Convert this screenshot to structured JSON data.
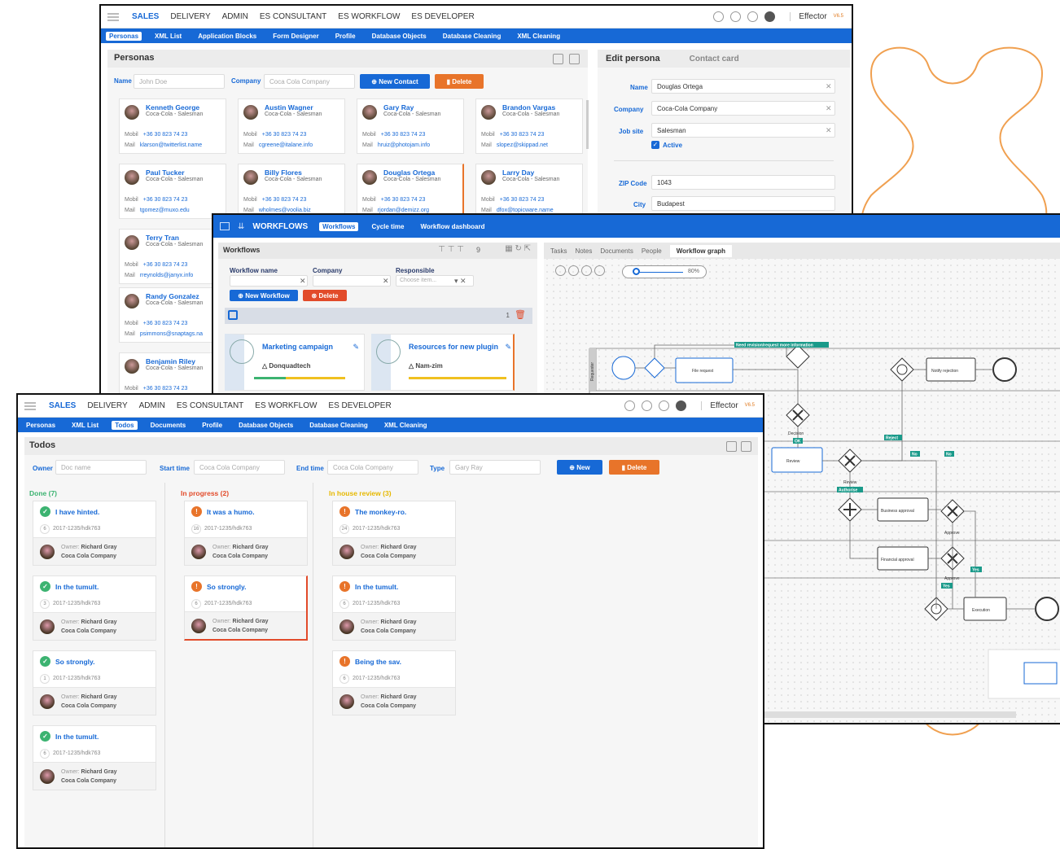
{
  "top_nav": {
    "items": [
      "SALES",
      "DELIVERY",
      "ADMIN",
      "ES CONSULTANT",
      "ES WORKFLOW",
      "ES DEVELOPER"
    ],
    "brand": "Effector",
    "version": "V6.5"
  },
  "personas_window": {
    "subnav": [
      "Personas",
      "XML List",
      "Application Blocks",
      "Form Designer",
      "Profile",
      "Database Objects",
      "Database Cleaning",
      "XML Cleaning"
    ],
    "title": "Personas",
    "filter": {
      "name_label": "Name",
      "name_placeholder": "John Doe",
      "company_label": "Company",
      "company_placeholder": "Coca Cola Company",
      "new_button": "New Contact",
      "delete_button": "Delete"
    },
    "mobil_label": "Mobil",
    "mail_label": "Mail",
    "contacts": [
      {
        "name": "Kenneth George",
        "role": "Coca-Cola - Salesman",
        "mobil": "+36 30 823 74 23",
        "mail": "klarson@twitterlist.name"
      },
      {
        "name": "Austin Wagner",
        "role": "Coca-Cola - Salesman",
        "mobil": "+36 30 823 74 23",
        "mail": "cgreene@italane.info"
      },
      {
        "name": "Gary Ray",
        "role": "Coca-Cola - Salesman",
        "mobil": "+36 30 823 74 23",
        "mail": "hruiz@photojam.info"
      },
      {
        "name": "Brandon Vargas",
        "role": "Coca-Cola - Salesman",
        "mobil": "+36 30 823 74 23",
        "mail": "slopez@skippad.net"
      },
      {
        "name": "Paul Tucker",
        "role": "Coca-Cola - Salesman",
        "mobil": "+36 30 823 74 23",
        "mail": "tgomez@muxo.edu"
      },
      {
        "name": "Billy Flores",
        "role": "Coca-Cola - Salesman",
        "mobil": "+36 30 823 74 23",
        "mail": "wholmes@voolia.biz"
      },
      {
        "name": "Douglas Ortega",
        "role": "Coca-Cola - Salesman",
        "mobil": "+36 30 823 74 23",
        "mail": "rjordan@demizz.org"
      },
      {
        "name": "Larry Day",
        "role": "Coca-Cola - Salesman",
        "mobil": "+36 30 823 74 23",
        "mail": "dfox@topicware.name"
      },
      {
        "name": "Terry Tran",
        "role": "Coca-Cola - Salesman",
        "mobil": "+36 30 823 74 23",
        "mail": "rreynolds@janyx.info"
      },
      {
        "name": "Randy Gonzalez",
        "role": "Coca-Cola - Salesman",
        "mobil": "+36 30 823 74 23",
        "mail": "psimmons@snaptags.na"
      },
      {
        "name": "Benjamin Riley",
        "role": "Coca-Cola - Salesman",
        "mobil": "+36 30 823 74 23",
        "mail": ""
      }
    ],
    "edit": {
      "tab_active": "Edit persona",
      "tab_other": "Contact card",
      "fields": [
        {
          "label": "Name",
          "value": "Douglas Ortega"
        },
        {
          "label": "Company",
          "value": "Coca-Cola Company"
        },
        {
          "label": "Job site",
          "value": "Salesman"
        }
      ],
      "active_label": "Active",
      "zip_label": "ZIP Code",
      "zip_value": "1043",
      "city_label": "City",
      "city_value": "Budapest"
    }
  },
  "workflows_window": {
    "title": "WORKFLOWS",
    "tabs": [
      "Workflows",
      "Cycle time",
      "Workflow dashboard"
    ],
    "panel_title": "Workflows",
    "count": "9",
    "filter": {
      "name_label": "Workflow name",
      "company_label": "Company",
      "responsible_label": "Responsible",
      "responsible_placeholder": "Choose item...",
      "new_button": "New Workflow",
      "delete_button": "Delete"
    },
    "group_count": "1",
    "cards": [
      {
        "title": "Marketing campaign",
        "company": "Donquadtech"
      },
      {
        "title": "Resources for new plugin",
        "company": "Nam-zim"
      }
    ],
    "right_tabs": [
      "Tasks",
      "Notes",
      "Documents",
      "People",
      "Workflow graph"
    ],
    "zoom": "80%",
    "graph": {
      "lane": "Requester",
      "nodes": {
        "file_request": "File request",
        "notify": "Notify rejection",
        "review": "Review",
        "business": "Business approval",
        "financial": "Financial approval",
        "execution": "Execution"
      },
      "labels": {
        "need_revision": "Need revision/request more information",
        "decision": "Decision",
        "ok": "OK",
        "reject": "Reject",
        "no1": "No",
        "no2": "No",
        "review_gw": "Review",
        "authorise": "Authorise",
        "approve1": "Approve",
        "approve2": "Approve",
        "yes1": "Yes",
        "yes2": "Yes"
      }
    }
  },
  "todos_window": {
    "subnav": [
      "Personas",
      "XML List",
      "Todos",
      "Documents",
      "Profile",
      "Database Objects",
      "Database Cleaning",
      "XML Cleaning"
    ],
    "title": "Todos",
    "filter": {
      "owner_label": "Owner",
      "owner_placeholder": "Doc name",
      "start_label": "Start time",
      "start_placeholder": "Coca Cola Company",
      "end_label": "End time",
      "end_placeholder": "Coca Cola Company",
      "type_label": "Type",
      "type_placeholder": "Gary Ray",
      "new_button": "New",
      "delete_button": "Delete"
    },
    "owner_prefix": "Owner:",
    "owner_name": "Richard Gray",
    "owner_company": "Coca Cola Company",
    "columns": [
      {
        "title": "Done (7)",
        "color": "#3cb371",
        "cards": [
          {
            "title": "I have hinted.",
            "count": "6",
            "id": "2017-1235/hdk763"
          },
          {
            "title": "In the tumult.",
            "count": "3",
            "id": "2017-1235/hdk763"
          },
          {
            "title": "So strongly.",
            "count": "1",
            "id": "2017-1235/hdk763"
          },
          {
            "title": "In the tumult.",
            "count": "6",
            "id": "2017-1235/hdk763"
          }
        ]
      },
      {
        "title": "In progress (2)",
        "color": "#e24b2a",
        "cards": [
          {
            "title": "It was a humo.",
            "count": "16",
            "id": "2017-1235/hdk763"
          },
          {
            "title": "So strongly.",
            "count": "6",
            "id": "2017-1235/hdk763"
          }
        ]
      },
      {
        "title": "In house review (3)",
        "color": "#e6b800",
        "cards": [
          {
            "title": "The monkey-ro.",
            "count": "24",
            "id": "2017-1235/hdk763"
          },
          {
            "title": "In the tumult.",
            "count": "6",
            "id": "2017-1235/hdk763"
          },
          {
            "title": "Being the sav.",
            "count": "6",
            "id": "2017-1235/hdk763"
          }
        ]
      }
    ]
  }
}
